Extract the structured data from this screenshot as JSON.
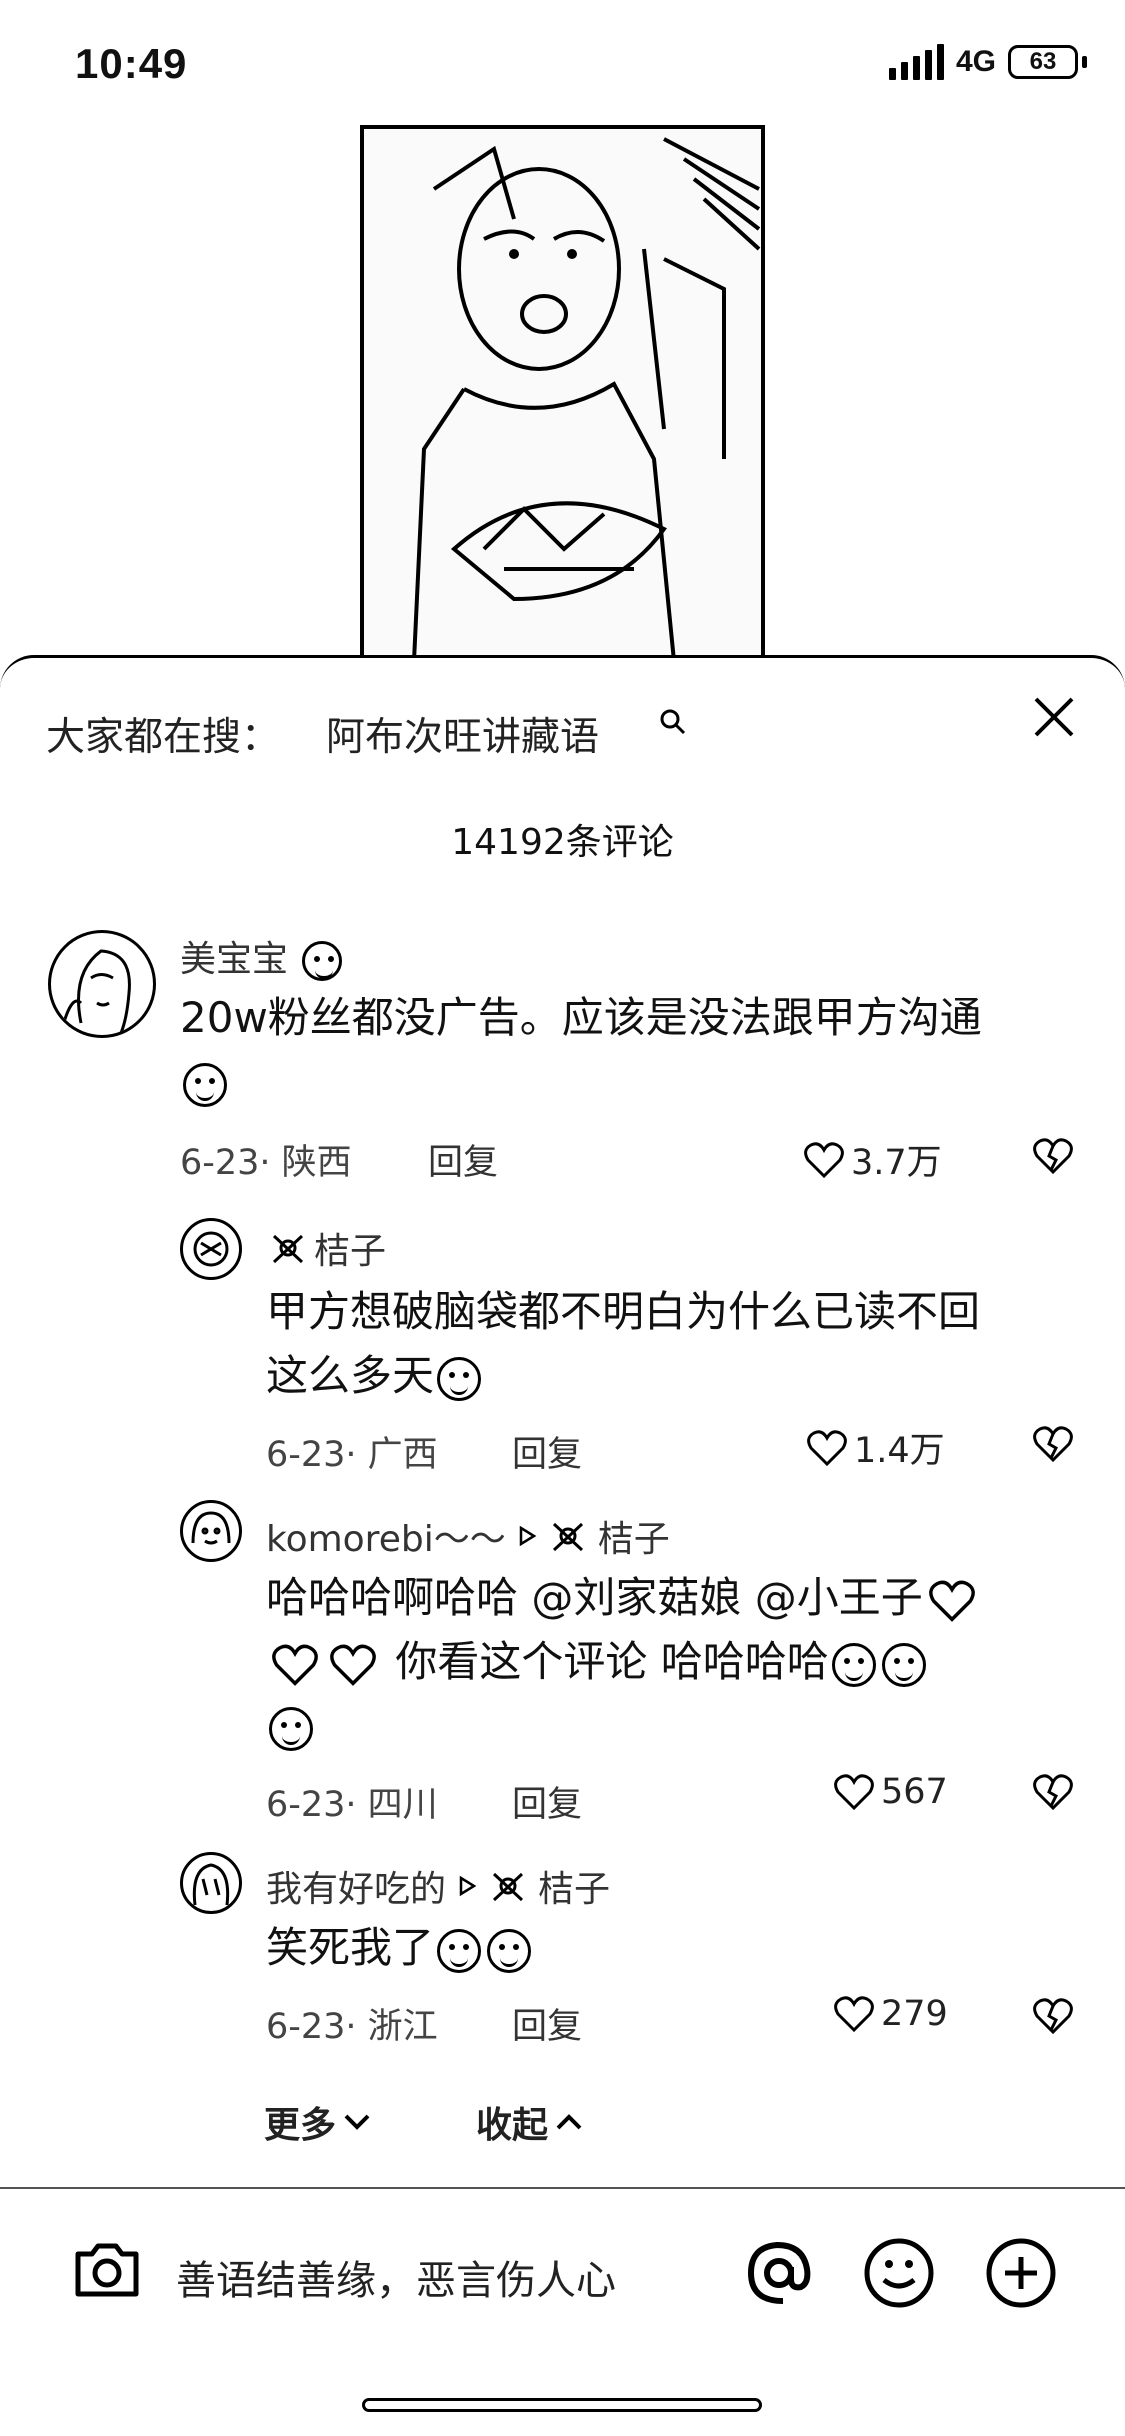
{
  "status_bar": {
    "time": "10:49",
    "network": "4G",
    "battery": "63"
  },
  "search_suggest": {
    "prefix": "大家都在搜：",
    "term": "阿布次旺讲藏语"
  },
  "comment_count": "14192条评论",
  "comments": [
    {
      "user": "美宝宝",
      "text": "20w粉丝都没广告。应该是没法跟甲方沟通",
      "date_loc": "6-23· 陕西",
      "reply": "回复",
      "likes": "3.7万"
    },
    {
      "user": "桔子",
      "text_line1": "甲方想破脑袋都不明白为什么已读不回",
      "text_line2": "这么多天",
      "date_loc": "6-23· 广西",
      "reply": "回复",
      "likes": "1.4万"
    },
    {
      "user": "komorebi～～",
      "reply_to": "桔子",
      "text_line1": "哈哈哈啊哈哈 @刘家菇娘 @小王子",
      "text_line2": "你看这个评论  哈哈哈哈",
      "date_loc": "6-23· 四川",
      "reply": "回复",
      "likes": "567"
    },
    {
      "user": "我有好吃的",
      "reply_to": "桔子",
      "text": "笑死我了",
      "date_loc": "6-23· 浙江",
      "reply": "回复",
      "likes": "279"
    }
  ],
  "thread_controls": {
    "more": "更多",
    "collapse": "收起"
  },
  "input": {
    "placeholder": "善语结善缘，恶言伤人心"
  },
  "icons": [
    "search-icon",
    "close-icon",
    "camera-icon",
    "at-icon",
    "emoji-icon",
    "add-icon",
    "heart-icon",
    "dislike-icon"
  ]
}
